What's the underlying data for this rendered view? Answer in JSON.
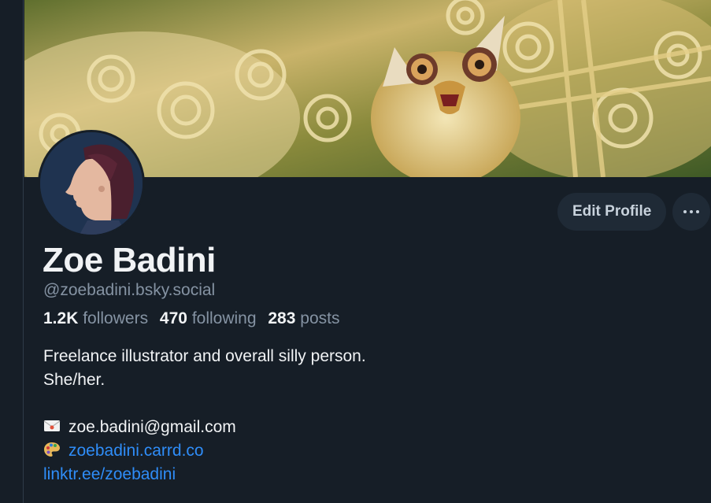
{
  "profile": {
    "display_name": "Zoe Badini",
    "handle": "@zoebadini.bsky.social",
    "stats": {
      "followers_count": "1.2K",
      "followers_label": "followers",
      "following_count": "470",
      "following_label": "following",
      "posts_count": "283",
      "posts_label": "posts"
    },
    "bio": {
      "line1": "Freelance illustrator and overall silly person.",
      "line2": "She/her.",
      "email": "zoe.badini@gmail.com",
      "website": "zoebadini.carrd.co",
      "linktree": "linktr.ee/zoebadini"
    },
    "icons": {
      "email": "envelope-emoji-icon",
      "website": "artist-palette-emoji-icon",
      "more": "ellipsis-icon"
    }
  },
  "actions": {
    "edit_profile_label": "Edit Profile"
  },
  "colors": {
    "background": "#161e27",
    "button_bg": "#1f2a36",
    "text_primary": "#f1f3f5",
    "text_secondary": "#8593a3",
    "link": "#2f8df8"
  }
}
